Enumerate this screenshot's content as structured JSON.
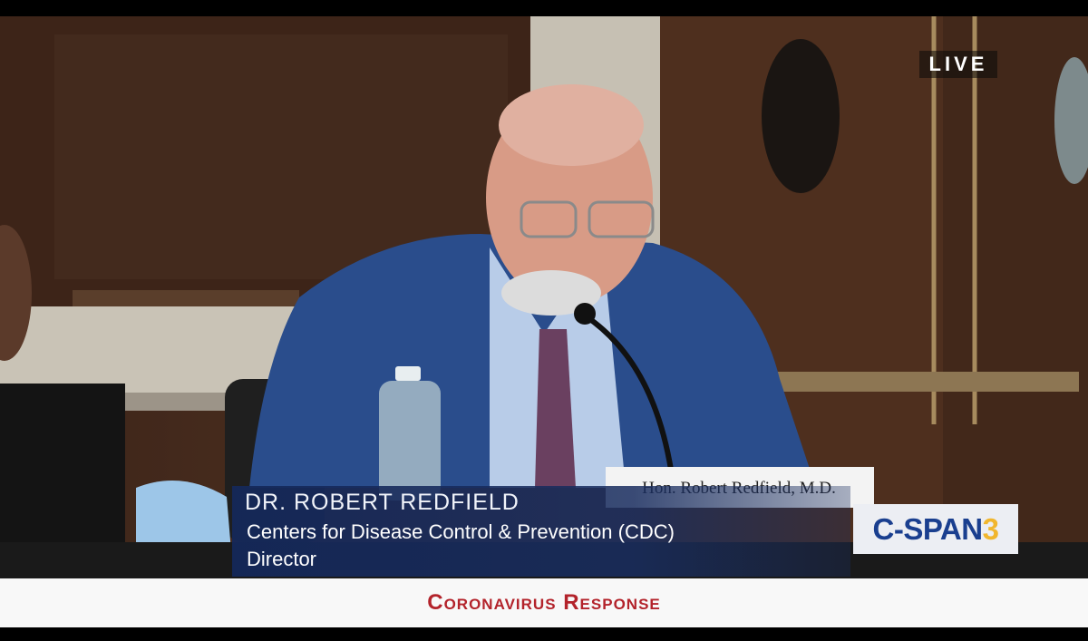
{
  "broadcast": {
    "status_badge": "LIVE",
    "network_logo": {
      "main": "C-SPAN",
      "number": "3"
    },
    "program_title": "Coronavirus Response"
  },
  "lower_third": {
    "name": "DR. ROBERT REDFIELD",
    "organization": "Centers for Disease Control & Prevention (CDC)",
    "role": "Director"
  },
  "scene": {
    "nameplate_text": "Hon. Robert Redfield, M.D."
  },
  "colors": {
    "lower_third_bg": "#1c2d5e",
    "logo_blue": "#1a3f8f",
    "logo_gold": "#f1b62d",
    "program_title_red": "#b3232b",
    "banner_bg": "#f8f8f8",
    "wood_panel": "#4a2d1e"
  }
}
